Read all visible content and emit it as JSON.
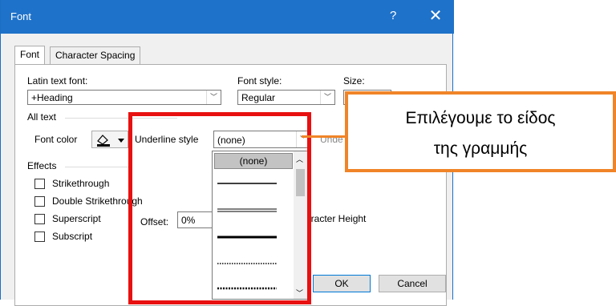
{
  "window": {
    "title": "Font",
    "help": "?",
    "close": "✕"
  },
  "tabs": [
    {
      "label": "Font"
    },
    {
      "label": "Character Spacing"
    }
  ],
  "latin": {
    "label": "Latin text font:",
    "value": "+Heading"
  },
  "style": {
    "label": "Font style:",
    "value": "Regular"
  },
  "size": {
    "label": "Size:",
    "value": "1"
  },
  "all_text": {
    "label": "All text"
  },
  "font_color": {
    "label": "Font color"
  },
  "underline_style": {
    "label": "Underline style",
    "value": "(none)"
  },
  "underline_color": {
    "label": "Unde"
  },
  "effects": {
    "label": "Effects",
    "items": [
      {
        "label": "Strikethrough"
      },
      {
        "label": "Double Strikethrough"
      },
      {
        "label": "Superscript"
      },
      {
        "label": "Subscript"
      }
    ],
    "offset_label": "Offset:",
    "offset_value": "0%",
    "char_height_label": "aracter Height"
  },
  "dropdown": {
    "selected": "(none)",
    "options": [
      "(none)",
      "single",
      "double",
      "thick",
      "dotted",
      "dotted-heavy"
    ]
  },
  "buttons": {
    "ok": "OK",
    "cancel": "Cancel"
  },
  "callout": {
    "line1": "Επιλέγουμε το είδος",
    "line2": "της γραμμής"
  },
  "colors": {
    "titlebar": "#1f72c9",
    "highlight_border": "#e81010",
    "callout_border": "#f08428"
  }
}
